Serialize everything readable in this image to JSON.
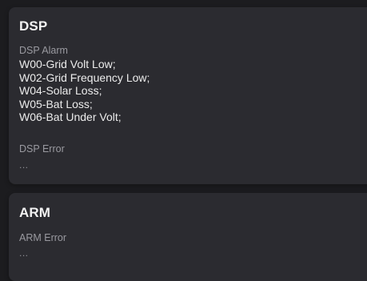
{
  "dsp": {
    "title": "DSP",
    "alarm_label": "DSP Alarm",
    "alarms": [
      "W00-Grid Volt Low;",
      "W02-Grid Frequency Low;",
      "W04-Solar Loss;",
      "W05-Bat Loss;",
      "W06-Bat Under Volt;"
    ],
    "error_label": "DSP Error",
    "error_value": "..."
  },
  "arm": {
    "title": "ARM",
    "error_label": "ARM Error",
    "error_value": "..."
  }
}
